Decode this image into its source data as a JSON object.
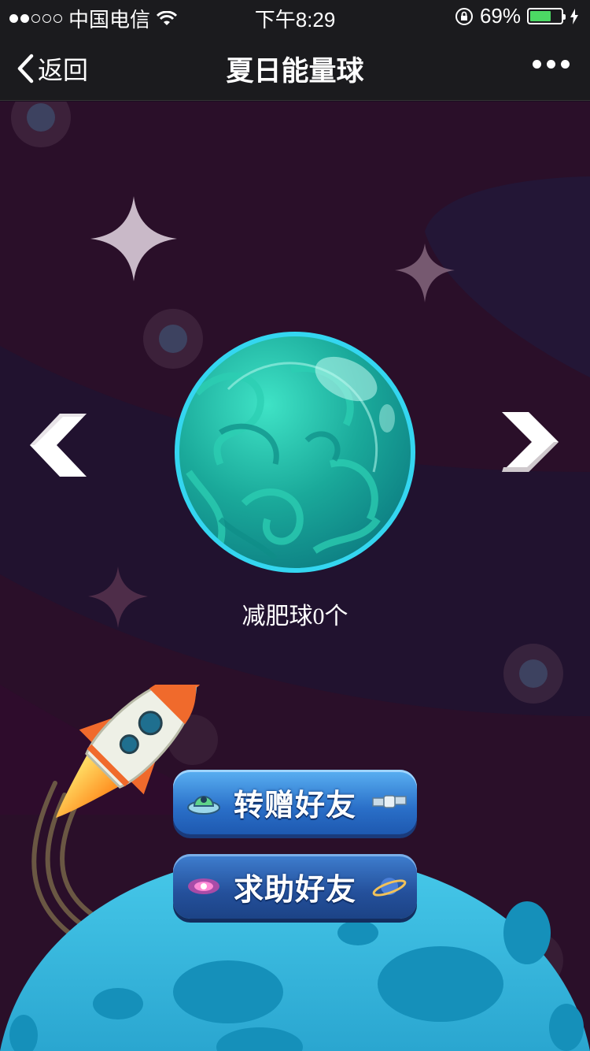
{
  "status_bar": {
    "carrier": "中国电信",
    "time": "下午8:29",
    "battery_percent_label": "69%",
    "battery_level": 0.69,
    "signal_bars": 2,
    "signal_total": 5
  },
  "nav": {
    "back_label": "返回",
    "title": "夏日能量球"
  },
  "planet": {
    "label": "减肥球0个"
  },
  "buttons": {
    "gift_label": "转赠好友",
    "help_label": "求助好友"
  },
  "colors": {
    "planet_teal": "#1fb0a0",
    "button_blue": "#2a6fc8",
    "moon_blue": "#37b8dd",
    "battery_green": "#4cd964"
  },
  "icons": [
    "chevron-left-icon",
    "more-dots-icon",
    "wifi-icon",
    "rotation-lock-icon",
    "charging-icon",
    "prev-arrow-icon",
    "next-arrow-icon",
    "ufo-icon",
    "satellite-icon",
    "galaxy-icon",
    "saturn-icon"
  ]
}
